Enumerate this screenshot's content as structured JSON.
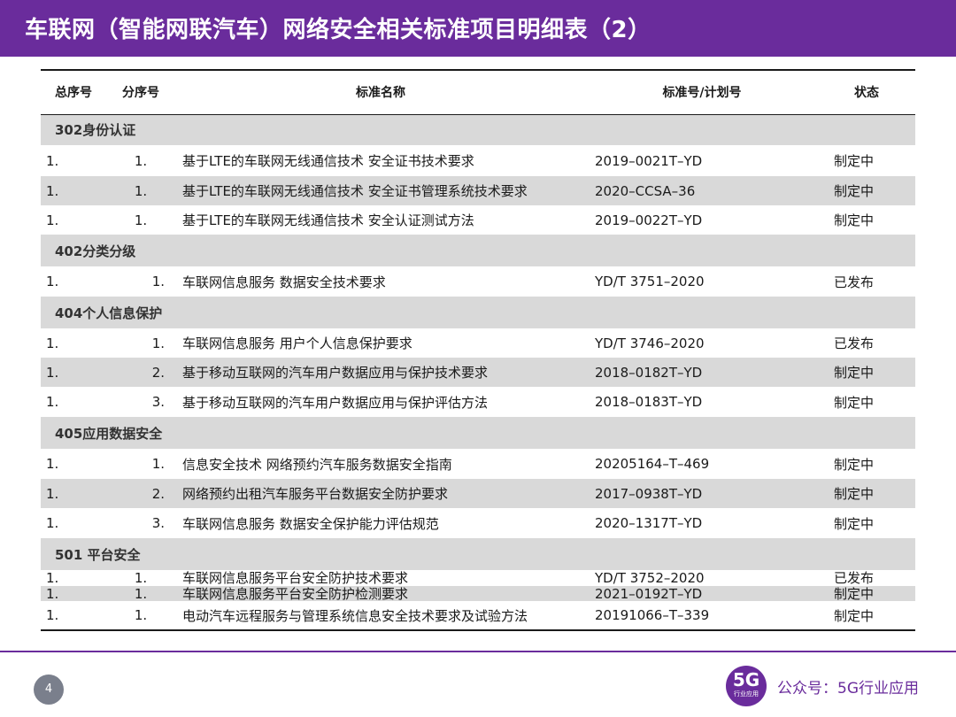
{
  "header": {
    "title": "车联网（智能网联汽车）网络安全相关标准项目明细表（2）"
  },
  "table": {
    "columns": {
      "seq": "总序号",
      "sub": "分序号",
      "name": "标准名称",
      "code": "标准号/计划号",
      "status": "状态"
    },
    "sections": {
      "s302": "302身份认证",
      "s402": "402分类分级",
      "s404": "404个人信息保护",
      "s405": "405应用数据安全",
      "s501": "501 平台安全"
    },
    "rows": {
      "r1": {
        "seq": "1.",
        "sub": "1.",
        "name": "基于LTE的车联网无线通信技术 安全证书技术要求",
        "code": "2019–0021T–YD",
        "status": "制定中"
      },
      "r2": {
        "seq": "1.",
        "sub": "1.",
        "name": "基于LTE的车联网无线通信技术 安全证书管理系统技术要求",
        "code": "2020–CCSA–36",
        "status": "制定中"
      },
      "r3": {
        "seq": "1.",
        "sub": "1.",
        "name": "基于LTE的车联网无线通信技术 安全认证测试方法",
        "code": "2019–0022T–YD",
        "status": "制定中"
      },
      "r4": {
        "seq": "1.",
        "sub": "1.",
        "name": "车联网信息服务 数据安全技术要求",
        "code": "YD/T 3751–2020",
        "status": "已发布"
      },
      "r5": {
        "seq": "1.",
        "sub": "1.",
        "name": "车联网信息服务 用户个人信息保护要求",
        "code": "YD/T 3746–2020",
        "status": "已发布"
      },
      "r6": {
        "seq": "1.",
        "sub": "2.",
        "name": "基于移动互联网的汽车用户数据应用与保护技术要求",
        "code": "2018–0182T–YD",
        "status": "制定中"
      },
      "r7": {
        "seq": "1.",
        "sub": "3.",
        "name": "基于移动互联网的汽车用户数据应用与保护评估方法",
        "code": "2018–0183T–YD",
        "status": "制定中"
      },
      "r8": {
        "seq": "1.",
        "sub": "1.",
        "name": "信息安全技术 网络预约汽车服务数据安全指南",
        "code": "20205164–T–469",
        "status": "制定中"
      },
      "r9": {
        "seq": "1.",
        "sub": "2.",
        "name": "网络预约出租汽车服务平台数据安全防护要求",
        "code": "2017–0938T–YD",
        "status": "制定中"
      },
      "r10": {
        "seq": "1.",
        "sub": "3.",
        "name": "车联网信息服务 数据安全保护能力评估规范",
        "code": "2020–1317T–YD",
        "status": "制定中"
      },
      "r11": {
        "seq": "1.",
        "sub": "1.",
        "name": "车联网信息服务平台安全防护技术要求",
        "code": "YD/T 3752–2020",
        "status": "已发布"
      },
      "r12": {
        "seq": "1.",
        "sub": "1.",
        "name": "车联网信息服务平台安全防护检测要求",
        "code": "2021–0192T–YD",
        "status": "制定中"
      },
      "r13": {
        "seq": "1.",
        "sub": "1.",
        "name": "电动汽车远程服务与管理系统信息安全技术要求及试验方法",
        "code": "20191066–T–339",
        "status": "制定中"
      }
    }
  },
  "footer": {
    "page_number": "4",
    "logo_main": "5G",
    "logo_sub": "行业应用",
    "account": "公众号：5G行业应用"
  }
}
